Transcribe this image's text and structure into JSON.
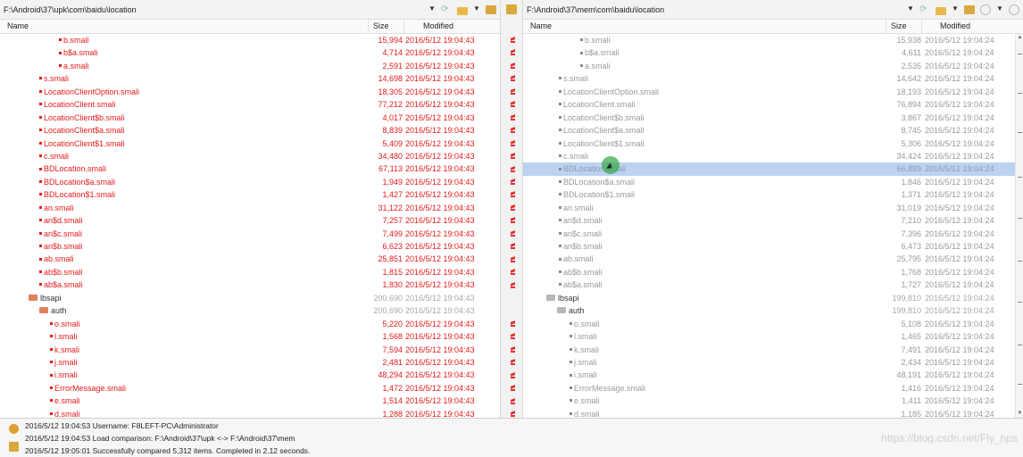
{
  "left": {
    "path": "F:\\Android\\37\\upk\\com\\baidu\\location",
    "columns": {
      "name": "Name",
      "size": "Size",
      "modified": "Modified"
    },
    "rows": [
      {
        "indent": 66,
        "kind": "file",
        "status": "diff",
        "name": "b.smali",
        "size": "15,994",
        "modified": "2016/5/12 19:04:43"
      },
      {
        "indent": 66,
        "kind": "file",
        "status": "diff",
        "name": "b$a.smali",
        "size": "4,714",
        "modified": "2016/5/12 19:04:43"
      },
      {
        "indent": 66,
        "kind": "file",
        "status": "diff",
        "name": "a.smali",
        "size": "2,591",
        "modified": "2016/5/12 19:04:43"
      },
      {
        "indent": 44,
        "kind": "file",
        "status": "diff",
        "name": "s.smali",
        "size": "14,698",
        "modified": "2016/5/12 19:04:43"
      },
      {
        "indent": 44,
        "kind": "file",
        "status": "diff",
        "name": "LocationClientOption.smali",
        "size": "18,305",
        "modified": "2016/5/12 19:04:43"
      },
      {
        "indent": 44,
        "kind": "file",
        "status": "diff",
        "name": "LocationClient.smali",
        "size": "77,212",
        "modified": "2016/5/12 19:04:43"
      },
      {
        "indent": 44,
        "kind": "file",
        "status": "diff",
        "name": "LocationClient$b.smali",
        "size": "4,017",
        "modified": "2016/5/12 19:04:43"
      },
      {
        "indent": 44,
        "kind": "file",
        "status": "diff",
        "name": "LocationClient$a.smali",
        "size": "8,839",
        "modified": "2016/5/12 19:04:43"
      },
      {
        "indent": 44,
        "kind": "file",
        "status": "diff",
        "name": "LocationClient$1.smali",
        "size": "5,409",
        "modified": "2016/5/12 19:04:43"
      },
      {
        "indent": 44,
        "kind": "file",
        "status": "diff",
        "name": "c.smali",
        "size": "34,480",
        "modified": "2016/5/12 19:04:43"
      },
      {
        "indent": 44,
        "kind": "file",
        "status": "diff",
        "name": "BDLocation.smali",
        "size": "67,113",
        "modified": "2016/5/12 19:04:43"
      },
      {
        "indent": 44,
        "kind": "file",
        "status": "diff",
        "name": "BDLocation$a.smali",
        "size": "1,949",
        "modified": "2016/5/12 19:04:43"
      },
      {
        "indent": 44,
        "kind": "file",
        "status": "diff",
        "name": "BDLocation$1.smali",
        "size": "1,427",
        "modified": "2016/5/12 19:04:43"
      },
      {
        "indent": 44,
        "kind": "file",
        "status": "diff",
        "name": "an.smali",
        "size": "31,122",
        "modified": "2016/5/12 19:04:43"
      },
      {
        "indent": 44,
        "kind": "file",
        "status": "diff",
        "name": "an$d.smali",
        "size": "7,257",
        "modified": "2016/5/12 19:04:43"
      },
      {
        "indent": 44,
        "kind": "file",
        "status": "diff",
        "name": "an$c.smali",
        "size": "7,499",
        "modified": "2016/5/12 19:04:43"
      },
      {
        "indent": 44,
        "kind": "file",
        "status": "diff",
        "name": "an$b.smali",
        "size": "6,623",
        "modified": "2016/5/12 19:04:43"
      },
      {
        "indent": 44,
        "kind": "file",
        "status": "diff",
        "name": "ab.smali",
        "size": "25,851",
        "modified": "2016/5/12 19:04:43"
      },
      {
        "indent": 44,
        "kind": "file",
        "status": "diff",
        "name": "ab$b.smali",
        "size": "1,815",
        "modified": "2016/5/12 19:04:43"
      },
      {
        "indent": 44,
        "kind": "file",
        "status": "diff",
        "name": "ab$a.smali",
        "size": "1,830",
        "modified": "2016/5/12 19:04:43"
      },
      {
        "indent": 32,
        "kind": "folder",
        "status": "dir",
        "name": "lbsapi",
        "size": "200,690",
        "modified": "2016/5/12 19:04:43"
      },
      {
        "indent": 44,
        "kind": "folder",
        "status": "dir",
        "name": "auth",
        "size": "200,690",
        "modified": "2016/5/12 19:04:43"
      },
      {
        "indent": 56,
        "kind": "file",
        "status": "diff",
        "name": "o.smali",
        "size": "5,220",
        "modified": "2016/5/12 19:04:43"
      },
      {
        "indent": 56,
        "kind": "file",
        "status": "diff",
        "name": "l.smali",
        "size": "1,568",
        "modified": "2016/5/12 19:04:43"
      },
      {
        "indent": 56,
        "kind": "file",
        "status": "diff",
        "name": "k.smali",
        "size": "7,594",
        "modified": "2016/5/12 19:04:43"
      },
      {
        "indent": 56,
        "kind": "file",
        "status": "diff",
        "name": "j.smali",
        "size": "2,481",
        "modified": "2016/5/12 19:04:43"
      },
      {
        "indent": 56,
        "kind": "file",
        "status": "diff",
        "name": "i.smali",
        "size": "48,294",
        "modified": "2016/5/12 19:04:43"
      },
      {
        "indent": 56,
        "kind": "file",
        "status": "diff",
        "name": "ErrorMessage.smali",
        "size": "1,472",
        "modified": "2016/5/12 19:04:43"
      },
      {
        "indent": 56,
        "kind": "file",
        "status": "diff",
        "name": "e.smali",
        "size": "1,514",
        "modified": "2016/5/12 19:04:43"
      },
      {
        "indent": 56,
        "kind": "file",
        "status": "diff",
        "name": "d.smali",
        "size": "1,288",
        "modified": "2016/5/12 19:04:43"
      }
    ]
  },
  "right": {
    "path": "F:\\Android\\37\\mem\\com\\baidu\\location",
    "columns": {
      "name": "Name",
      "size": "Size",
      "modified": "Modified"
    },
    "selected_index": 10,
    "rows": [
      {
        "indent": 64,
        "kind": "file",
        "status": "same",
        "name": "b.smali",
        "size": "15,938",
        "modified": "2016/5/12 19:04:24"
      },
      {
        "indent": 64,
        "kind": "file",
        "status": "same",
        "name": "b$a.smali",
        "size": "4,611",
        "modified": "2016/5/12 19:04:24"
      },
      {
        "indent": 64,
        "kind": "file",
        "status": "same",
        "name": "a.smali",
        "size": "2,535",
        "modified": "2016/5/12 19:04:24"
      },
      {
        "indent": 40,
        "kind": "file",
        "status": "same",
        "name": "s.smali",
        "size": "14,642",
        "modified": "2016/5/12 19:04:24"
      },
      {
        "indent": 40,
        "kind": "file",
        "status": "same",
        "name": "LocationClientOption.smali",
        "size": "18,193",
        "modified": "2016/5/12 19:04:24"
      },
      {
        "indent": 40,
        "kind": "file",
        "status": "same",
        "name": "LocationClient.smali",
        "size": "76,894",
        "modified": "2016/5/12 19:04:24"
      },
      {
        "indent": 40,
        "kind": "file",
        "status": "same",
        "name": "LocationClient$b.smali",
        "size": "3,867",
        "modified": "2016/5/12 19:04:24"
      },
      {
        "indent": 40,
        "kind": "file",
        "status": "same",
        "name": "LocationClient$a.smali",
        "size": "8,745",
        "modified": "2016/5/12 19:04:24"
      },
      {
        "indent": 40,
        "kind": "file",
        "status": "same",
        "name": "LocationClient$1.smali",
        "size": "5,306",
        "modified": "2016/5/12 19:04:24"
      },
      {
        "indent": 40,
        "kind": "file",
        "status": "same",
        "name": "c.smali",
        "size": "34,424",
        "modified": "2016/5/12 19:04:24"
      },
      {
        "indent": 40,
        "kind": "file",
        "status": "same",
        "name": "BDLocation.smali",
        "size": "66,889",
        "modified": "2016/5/12 19:04:24"
      },
      {
        "indent": 40,
        "kind": "file",
        "status": "same",
        "name": "BDLocation$a.smali",
        "size": "1,846",
        "modified": "2016/5/12 19:04:24"
      },
      {
        "indent": 40,
        "kind": "file",
        "status": "same",
        "name": "BDLocation$1.smali",
        "size": "1,371",
        "modified": "2016/5/12 19:04:24"
      },
      {
        "indent": 40,
        "kind": "file",
        "status": "same",
        "name": "an.smali",
        "size": "31,019",
        "modified": "2016/5/12 19:04:24"
      },
      {
        "indent": 40,
        "kind": "file",
        "status": "same",
        "name": "an$d.smali",
        "size": "7,210",
        "modified": "2016/5/12 19:04:24"
      },
      {
        "indent": 40,
        "kind": "file",
        "status": "same",
        "name": "an$c.smali",
        "size": "7,396",
        "modified": "2016/5/12 19:04:24"
      },
      {
        "indent": 40,
        "kind": "file",
        "status": "same",
        "name": "an$b.smali",
        "size": "6,473",
        "modified": "2016/5/12 19:04:24"
      },
      {
        "indent": 40,
        "kind": "file",
        "status": "same",
        "name": "ab.smali",
        "size": "25,795",
        "modified": "2016/5/12 19:04:24"
      },
      {
        "indent": 40,
        "kind": "file",
        "status": "same",
        "name": "ab$b.smali",
        "size": "1,768",
        "modified": "2016/5/12 19:04:24"
      },
      {
        "indent": 40,
        "kind": "file",
        "status": "same",
        "name": "ab$a.smali",
        "size": "1,727",
        "modified": "2016/5/12 19:04:24"
      },
      {
        "indent": 26,
        "kind": "folder",
        "status": "dir",
        "name": "lbsapi",
        "size": "199,810",
        "modified": "2016/5/12 19:04:24"
      },
      {
        "indent": 38,
        "kind": "folder",
        "status": "dir",
        "name": "auth",
        "size": "199,810",
        "modified": "2016/5/12 19:04:24"
      },
      {
        "indent": 52,
        "kind": "file",
        "status": "same",
        "name": "o.smali",
        "size": "5,108",
        "modified": "2016/5/12 19:04:24"
      },
      {
        "indent": 52,
        "kind": "file",
        "status": "same",
        "name": "l.smali",
        "size": "1,465",
        "modified": "2016/5/12 19:04:24"
      },
      {
        "indent": 52,
        "kind": "file",
        "status": "same",
        "name": "k.smali",
        "size": "7,491",
        "modified": "2016/5/12 19:04:24"
      },
      {
        "indent": 52,
        "kind": "file",
        "status": "same",
        "name": "j.smali",
        "size": "2,434",
        "modified": "2016/5/12 19:04:24"
      },
      {
        "indent": 52,
        "kind": "file",
        "status": "same",
        "name": "i.smali",
        "size": "48,191",
        "modified": "2016/5/12 19:04:24"
      },
      {
        "indent": 52,
        "kind": "file",
        "status": "same",
        "name": "ErrorMessage.smali",
        "size": "1,416",
        "modified": "2016/5/12 19:04:24"
      },
      {
        "indent": 52,
        "kind": "file",
        "status": "same",
        "name": "e.smali",
        "size": "1,411",
        "modified": "2016/5/12 19:04:24"
      },
      {
        "indent": 52,
        "kind": "file",
        "status": "same",
        "name": "d.smali",
        "size": "1,185",
        "modified": "2016/5/12 19:04:24"
      }
    ]
  },
  "log": [
    "2016/5/12 19:04:53  Username: F8LEFT-PC\\Administrator",
    "2016/5/12 19:04:53  Load comparison: F:\\Android\\37\\upk <-> F:\\Android\\37\\mem",
    "2016/5/12 19:05:01  Successfully compared 5,312 items.  Completed in 2.12 seconds."
  ],
  "watermark": "https://blog.csdn.net/Fly_hps",
  "colors": {
    "diff": "#e41b1b",
    "same": "#9a9a9a",
    "selection": "#bcd3ef",
    "folder": "#e08060"
  },
  "icons": [
    "dropdown-arrow-icon",
    "folder-open-icon",
    "up-folder-icon",
    "refresh-icon",
    "next-diff-icon",
    "diff-marker-icon"
  ]
}
